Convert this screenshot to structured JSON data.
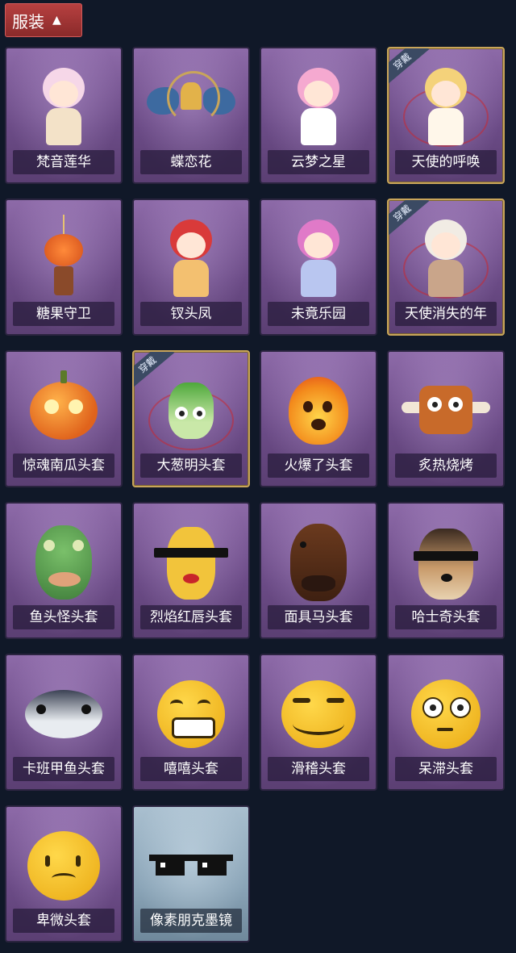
{
  "section": {
    "label": "服装",
    "icon": "chevron-up-icon"
  },
  "equipped_tag": "穿戴",
  "items": [
    {
      "name": "梵音莲华",
      "icon": "anime-character-figure",
      "equipped": false,
      "theme": "purple"
    },
    {
      "name": "蝶恋花",
      "icon": "butterfly-bell-ornament",
      "equipped": false,
      "theme": "purple"
    },
    {
      "name": "云梦之星",
      "icon": "unicorn-on-cloud",
      "equipped": false,
      "theme": "purple"
    },
    {
      "name": "天使的呼唤",
      "icon": "angel-figure",
      "equipped": true,
      "theme": "purple"
    },
    {
      "name": "糖果守卫",
      "icon": "pumpkin-scarecrow-ornament",
      "equipped": false,
      "theme": "purple"
    },
    {
      "name": "钗头凤",
      "icon": "phoenix-crown-figure",
      "equipped": false,
      "theme": "purple"
    },
    {
      "name": "未竟乐园",
      "icon": "pink-hair-girl-figure",
      "equipped": false,
      "theme": "purple"
    },
    {
      "name": "天使消失的年",
      "icon": "veiled-girl-figure",
      "equipped": true,
      "theme": "purple"
    },
    {
      "name": "惊魂南瓜头套",
      "icon": "pumpkin-head",
      "equipped": false,
      "theme": "purple"
    },
    {
      "name": "大葱明头套",
      "icon": "scallion-head",
      "equipped": true,
      "theme": "purple"
    },
    {
      "name": "火爆了头套",
      "icon": "fire-head",
      "equipped": false,
      "theme": "purple"
    },
    {
      "name": "炙热烧烤",
      "icon": "meat-head",
      "equipped": false,
      "theme": "purple"
    },
    {
      "name": "鱼头怪头套",
      "icon": "fish-mask",
      "equipped": false,
      "theme": "purple"
    },
    {
      "name": "烈焰红唇头套",
      "icon": "yellow-mask-sunglasses",
      "equipped": false,
      "theme": "purple"
    },
    {
      "name": "面具马头套",
      "icon": "horse-mask",
      "equipped": false,
      "theme": "purple"
    },
    {
      "name": "哈士奇头套",
      "icon": "husky-mask",
      "equipped": false,
      "theme": "purple"
    },
    {
      "name": "卡班甲鱼头套",
      "icon": "fish-head-mask",
      "equipped": false,
      "theme": "purple"
    },
    {
      "name": "嘻嘻头套",
      "icon": "grin-emoji",
      "equipped": false,
      "theme": "purple"
    },
    {
      "name": "滑稽头套",
      "icon": "silly-emoji",
      "equipped": false,
      "theme": "purple"
    },
    {
      "name": "呆滞头套",
      "icon": "stare-emoji",
      "equipped": false,
      "theme": "purple"
    },
    {
      "name": "卑微头套",
      "icon": "shy-emoji",
      "equipped": false,
      "theme": "purple"
    },
    {
      "name": "像素朋克墨镜",
      "icon": "pixel-sunglasses",
      "equipped": false,
      "theme": "blue"
    }
  ],
  "colors": {
    "background": "#101828",
    "tab": "#a83838",
    "card": "#7a5896",
    "card_blue": "#8aa4b7",
    "equipped_border": "#c9a55a"
  }
}
